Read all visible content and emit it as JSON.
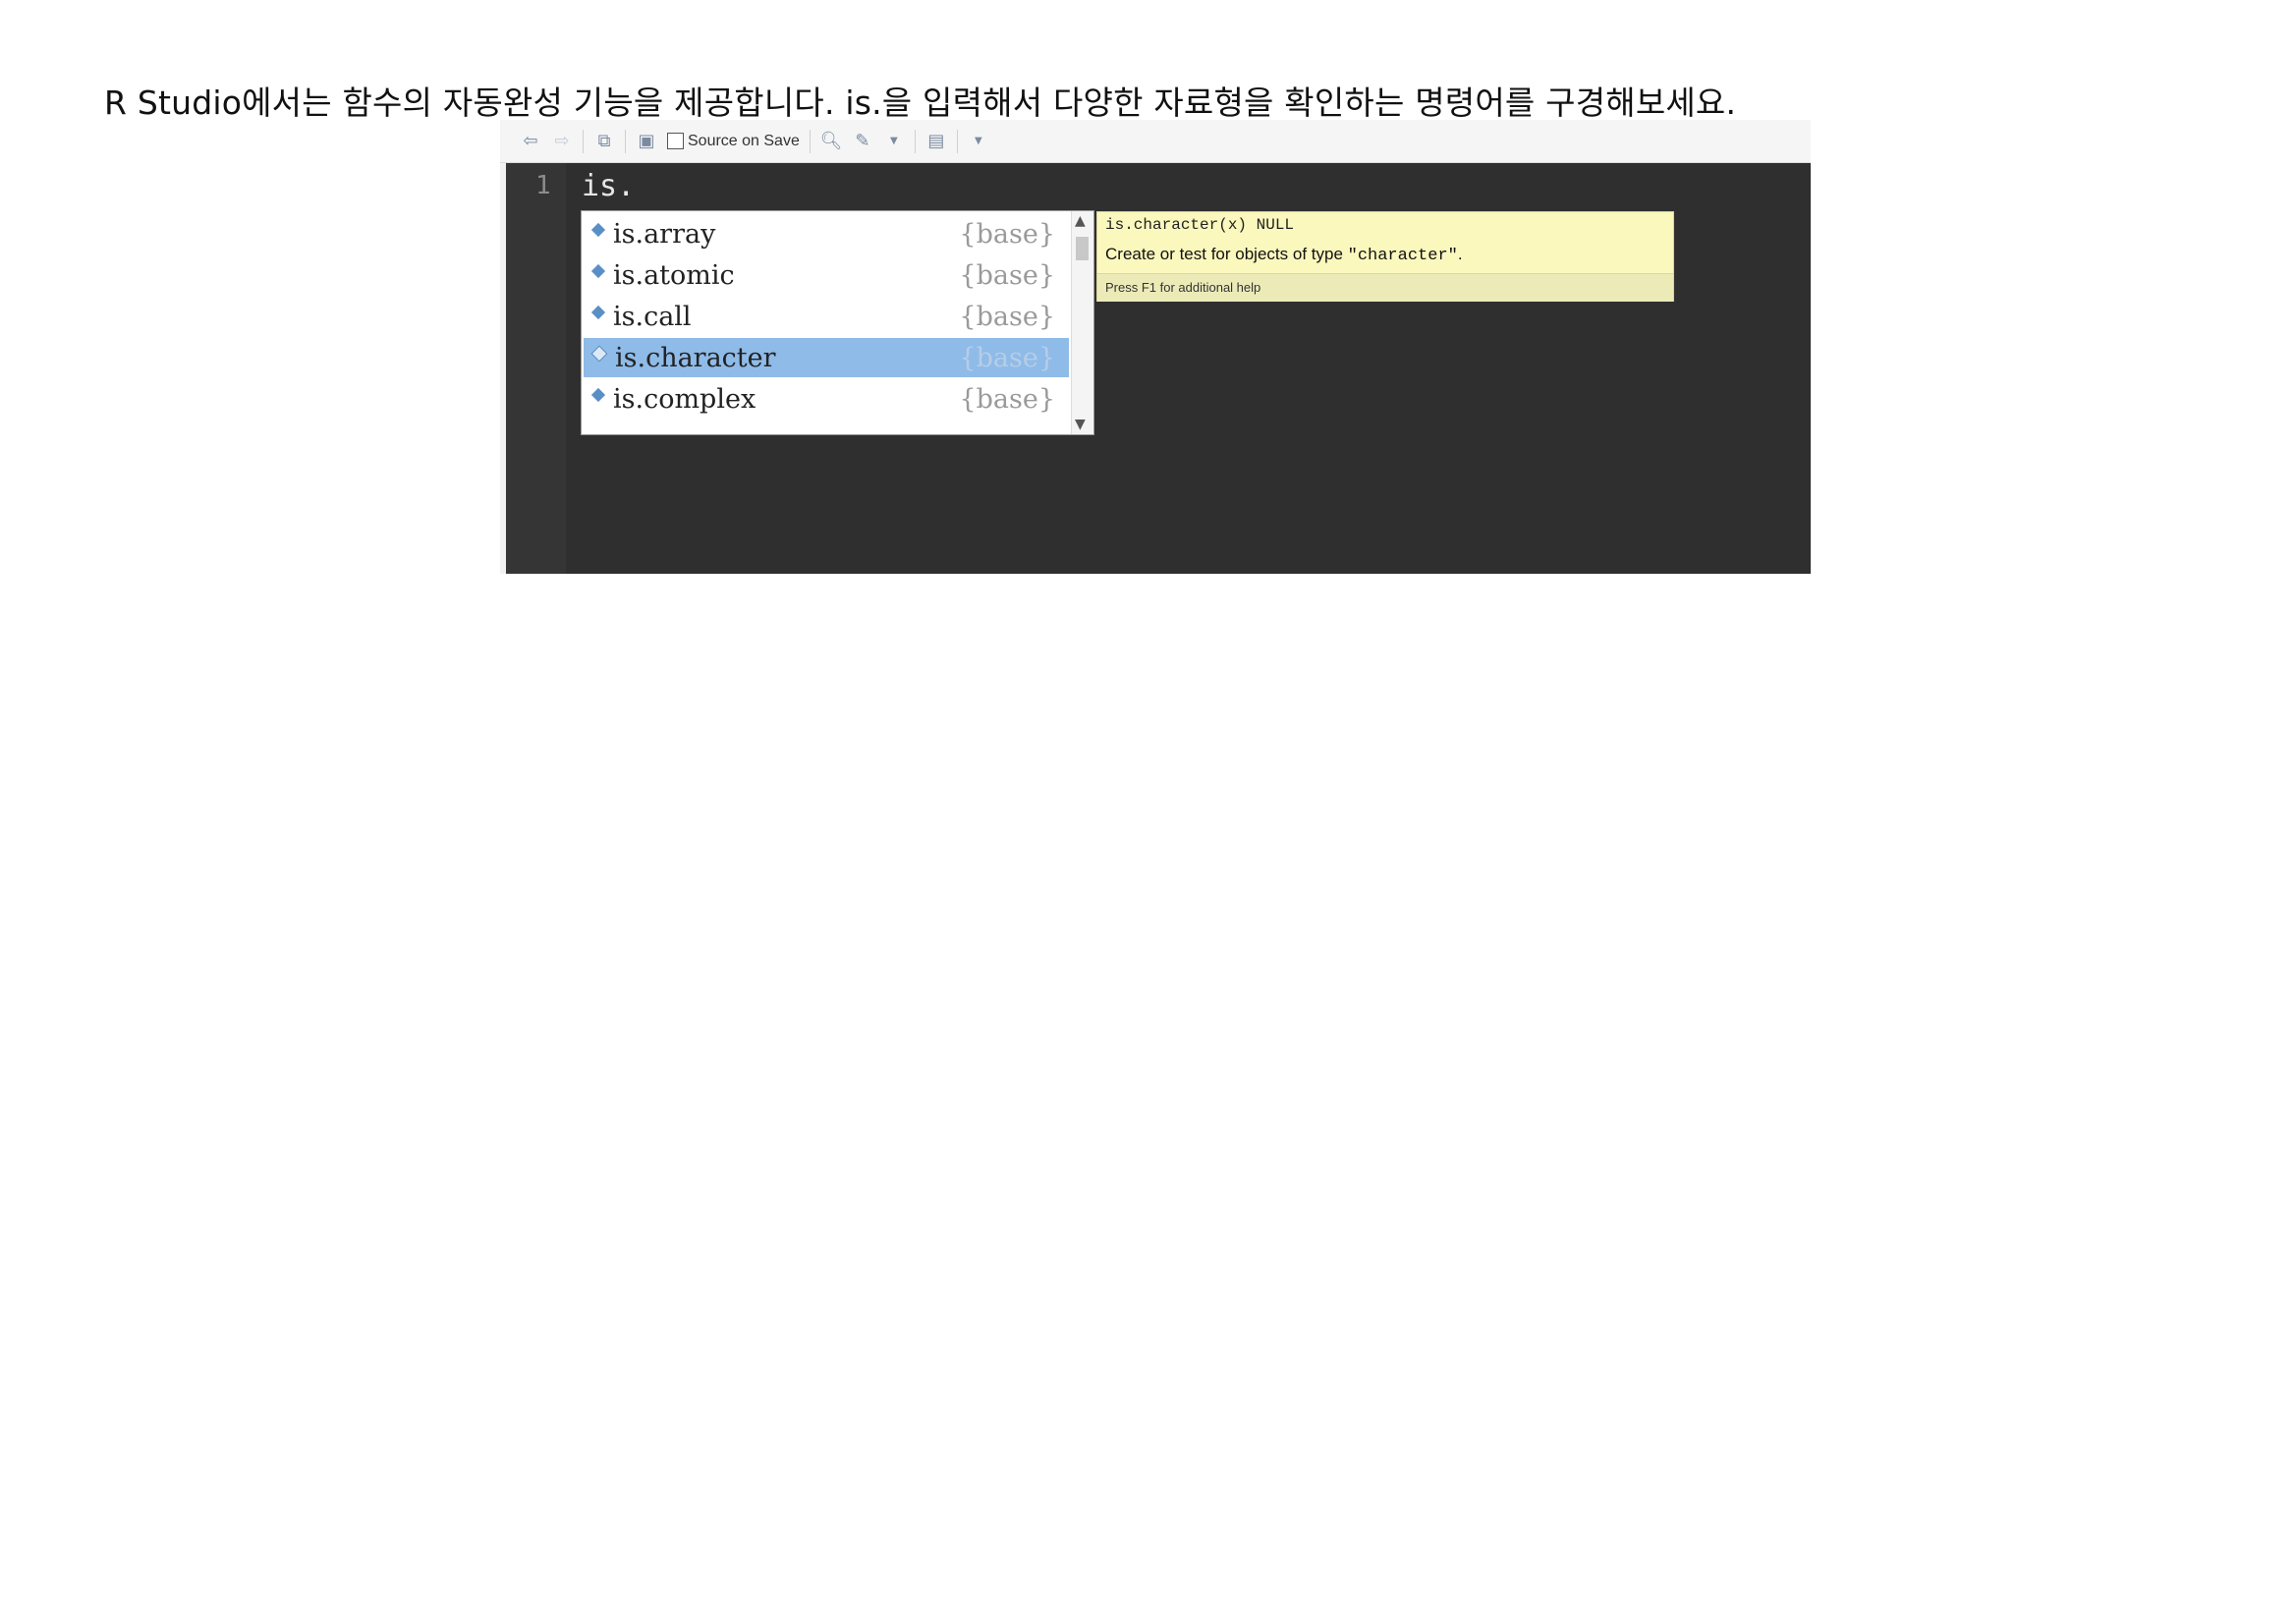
{
  "instruction": "R Studio에서는 함수의 자동완성 기능을 제공합니다. is.을 입력해서 다양한 자료형을 확인하는 명령어를 구경해보세요.",
  "toolbar": {
    "source_on_save_label": "Source on Save"
  },
  "editor": {
    "line_number": "1",
    "code": "is."
  },
  "autocomplete": {
    "items": [
      {
        "name": "is.array",
        "pkg": "{base}"
      },
      {
        "name": "is.atomic",
        "pkg": "{base}"
      },
      {
        "name": "is.call",
        "pkg": "{base}"
      },
      {
        "name": "is.character",
        "pkg": "{base}",
        "selected": true
      },
      {
        "name": "is.complex",
        "pkg": "{base}"
      }
    ]
  },
  "tooltip": {
    "signature": "is.character(x) NULL",
    "description_prefix": "Create or test for objects of type ",
    "description_code": "\"character\"",
    "description_suffix": ".",
    "footer": "Press F1 for additional help"
  },
  "colors": {
    "editor_bg": "#2f2f2f",
    "selection": "#8fbbe8",
    "tooltip_bg": "#fbf8bd"
  }
}
